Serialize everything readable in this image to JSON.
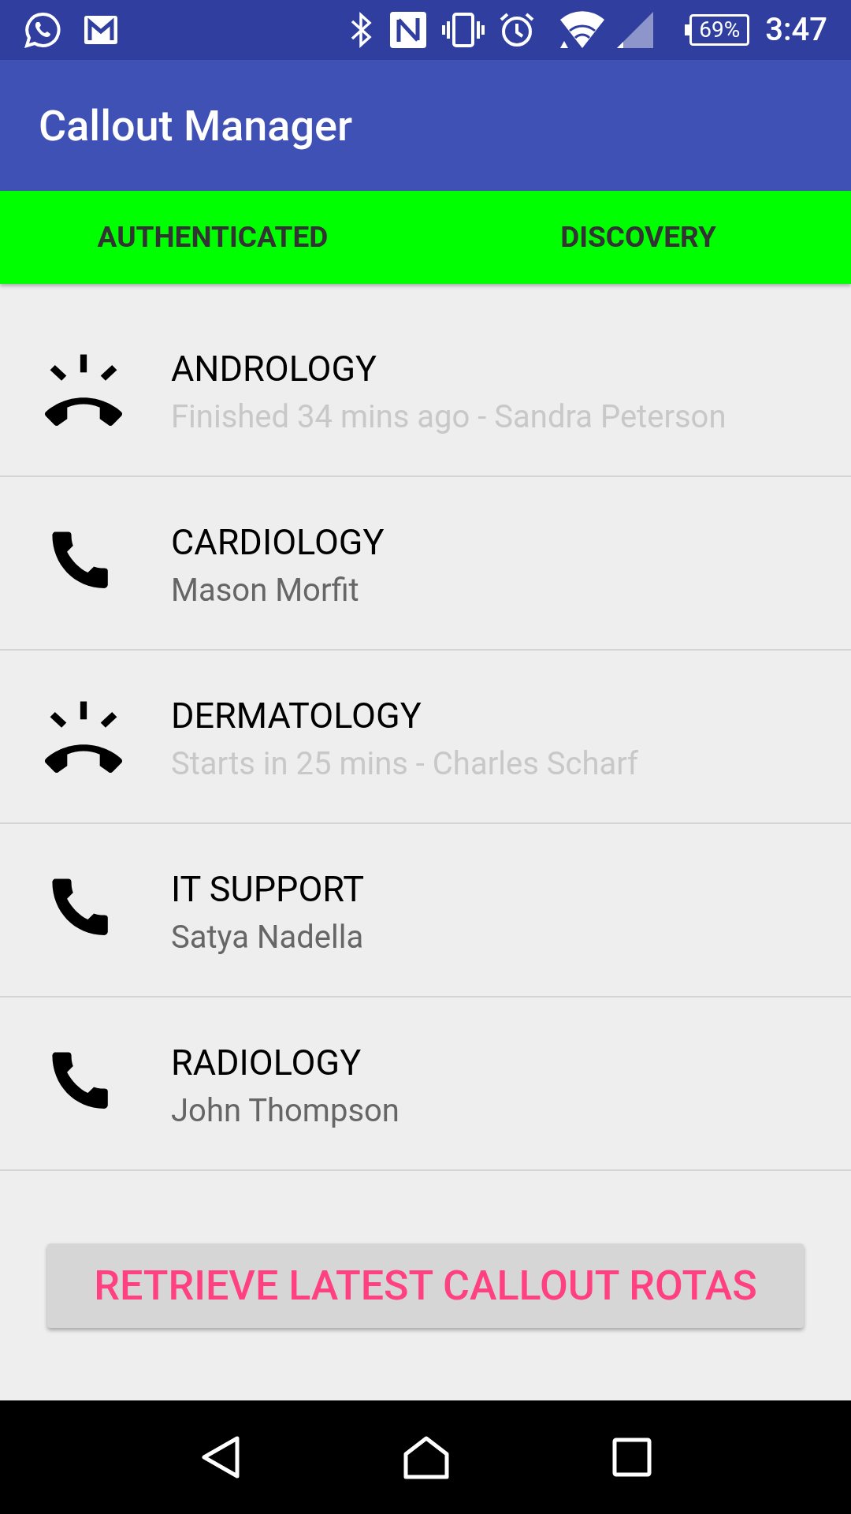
{
  "status_bar": {
    "battery": "69%",
    "time": "3:47"
  },
  "app_bar": {
    "title": "Callout Manager"
  },
  "tabs": [
    {
      "label": "AUTHENTICATED"
    },
    {
      "label": "DISCOVERY"
    }
  ],
  "callouts": [
    {
      "name": "ANDROLOGY",
      "detail": "Finished 34 mins ago - Sandra Peterson",
      "active": false
    },
    {
      "name": "CARDIOLOGY",
      "detail": "Mason Morfit",
      "active": true
    },
    {
      "name": "DERMATOLOGY",
      "detail": "Starts in 25 mins - Charles Scharf",
      "active": false
    },
    {
      "name": "IT SUPPORT",
      "detail": "Satya Nadella",
      "active": true
    },
    {
      "name": "RADIOLOGY",
      "detail": "John Thompson",
      "active": true
    }
  ],
  "button": {
    "label": "RETRIEVE LATEST CALLOUT ROTAS"
  }
}
